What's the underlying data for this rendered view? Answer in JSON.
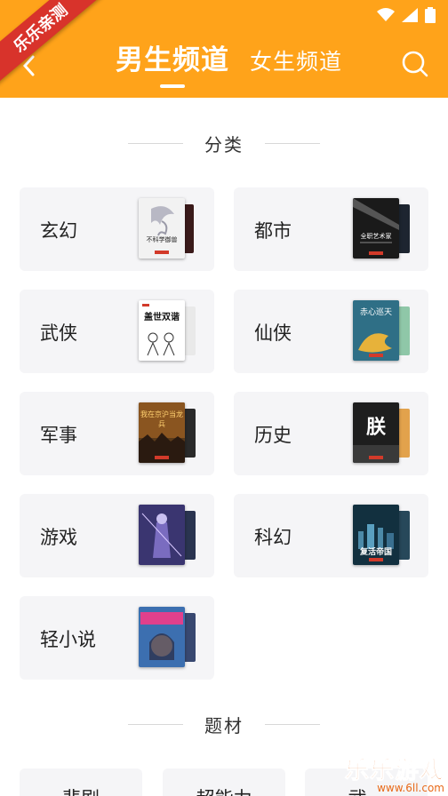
{
  "header": {
    "tab_male": "男生频道",
    "tab_female": "女生频道",
    "accent": "#FFA31A"
  },
  "status_icons": [
    "wifi-icon",
    "signal-icon",
    "battery-icon"
  ],
  "categories_section": {
    "title": "分类"
  },
  "categories": [
    {
      "label": "玄幻",
      "cover_title": "不科学御兽"
    },
    {
      "label": "都市",
      "cover_title": "全职艺术家"
    },
    {
      "label": "武侠",
      "cover_title": "盖世双谐"
    },
    {
      "label": "仙侠",
      "cover_title": "赤心巡天"
    },
    {
      "label": "军事",
      "cover_title": "我在京沪当龙兵"
    },
    {
      "label": "历史",
      "cover_title": "朕"
    },
    {
      "label": "游戏",
      "cover_title": ""
    },
    {
      "label": "科幻",
      "cover_title": "复活帝国"
    },
    {
      "label": "轻小说",
      "cover_title": ""
    }
  ],
  "topics_section": {
    "title": "题材"
  },
  "topics": [
    {
      "label": "悲剧"
    },
    {
      "label": "超能力"
    },
    {
      "label": "武..."
    }
  ],
  "watermark": {
    "ribbon": "乐乐亲测",
    "brand": "乐乐游戏",
    "url": "www.6ll.com"
  }
}
